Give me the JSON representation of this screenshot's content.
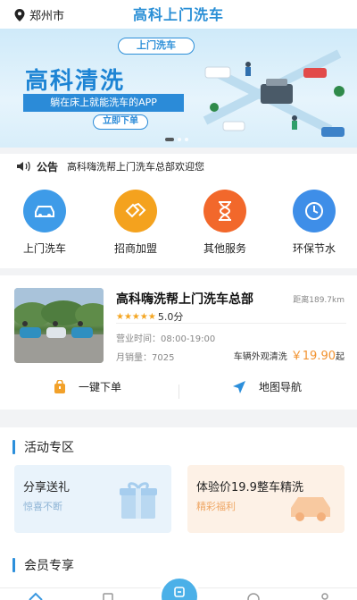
{
  "header": {
    "location": "郑州市",
    "title": "高科上门洗车",
    "icons": [
      "location-pin-icon"
    ]
  },
  "banner": {
    "tag": "上门洗车",
    "headline": "高科清洗",
    "subline": "躺在床上就能洗车的APP",
    "cta": "立即下单"
  },
  "notice": {
    "label": "公告",
    "text": "高科嗨洗帮上门洗车总部欢迎您",
    "icon": "speaker-icon"
  },
  "services": [
    {
      "label": "上门洗车",
      "icon": "car-icon",
      "color": "#3e9be8"
    },
    {
      "label": "招商加盟",
      "icon": "handshake-icon",
      "color": "#f4a21e"
    },
    {
      "label": "其他服务",
      "icon": "hourglass-icon",
      "color": "#f2682b"
    },
    {
      "label": "环保节水",
      "icon": "clock-icon",
      "color": "#3e8ee8"
    }
  ],
  "store": {
    "name": "高科嗨洗帮上门洗车总部",
    "distance": "距离189.7km",
    "stars": "★★★★★",
    "rating": "5.0分",
    "hours": "营业时间：08:00-19:00",
    "sales": "月销量：7025",
    "service_name": "车辆外观清洗",
    "price": "￥19.90",
    "price_suffix": "起",
    "action_order": "一键下单",
    "action_nav": "地图导航"
  },
  "activity": {
    "title": "活动专区",
    "promos": [
      {
        "title": "分享送礼",
        "subtitle": "惊喜不断",
        "accent": "#3c8fd8"
      },
      {
        "title": "体验价19.9整车精洗",
        "subtitle": "精彩福利",
        "accent": "#f08a34"
      }
    ]
  },
  "member": {
    "title": "会员专享"
  },
  "colors": {
    "primary": "#2c8fdb",
    "price": "#f29330",
    "star": "#f4a623"
  }
}
